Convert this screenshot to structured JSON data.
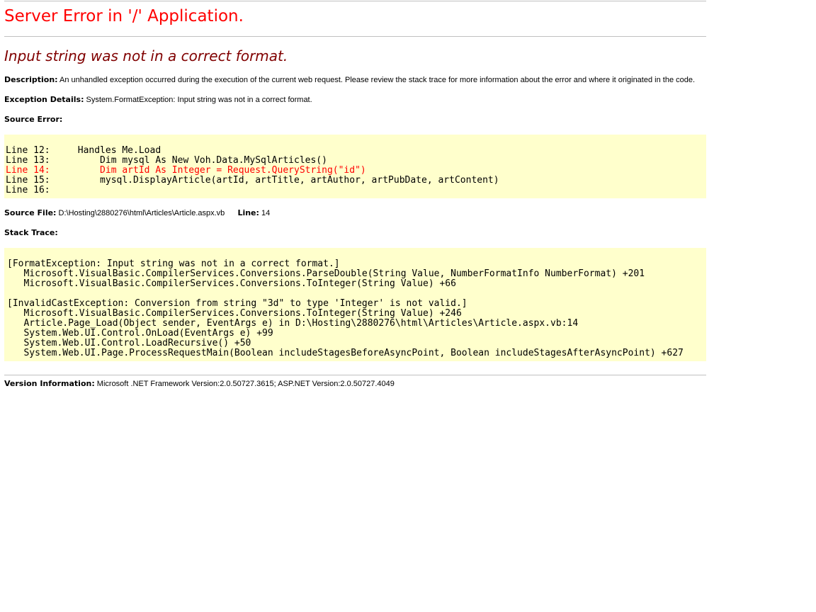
{
  "page": {
    "title": "Server Error in '/' Application.",
    "error_message": "Input string was not in a correct format.",
    "description_label": "Description:",
    "description_text": "An unhandled exception occurred during the execution of the current web request. Please review the stack trace for more information about the error and where it originated in the code.",
    "exception_label": "Exception Details:",
    "exception_text": "System.FormatException: Input string was not in a correct format.",
    "source_error_label": "Source Error:",
    "source_lines": [
      "Line 12:     Handles Me.Load",
      "Line 13:         Dim mysql As New Voh.Data.MySqlArticles()",
      "Line 14:         Dim artId As Integer = Request.QueryString(\"id\")",
      "Line 15:         mysql.DisplayArticle(artId, artTitle, artAuthor, artPubDate, artContent)",
      "Line 16: "
    ],
    "source_file_label": "Source File:",
    "source_file_value": "D:\\Hosting\\2880276\\html\\Articles\\Article.aspx.vb",
    "line_label": "Line:",
    "line_value": "14",
    "stack_trace_label": "Stack Trace:",
    "stack_lines": [
      "[FormatException: Input string was not in a correct format.]",
      "   Microsoft.VisualBasic.CompilerServices.Conversions.ParseDouble(String Value, NumberFormatInfo NumberFormat) +201",
      "   Microsoft.VisualBasic.CompilerServices.Conversions.ToInteger(String Value) +66",
      "",
      "[InvalidCastException: Conversion from string \"3d\" to type 'Integer' is not valid.]",
      "   Microsoft.VisualBasic.CompilerServices.Conversions.ToInteger(String Value) +246",
      "   Article.Page_Load(Object sender, EventArgs e) in D:\\Hosting\\2880276\\html\\Articles\\Article.aspx.vb:14",
      "   System.Web.UI.Control.OnLoad(EventArgs e) +99",
      "   System.Web.UI.Control.LoadRecursive() +50",
      "   System.Web.UI.Page.ProcessRequestMain(Boolean includeStagesBeforeAsyncPoint, Boolean includeStagesAfterAsyncPoint) +627"
    ],
    "version_label": "Version Information:",
    "version_text": "Microsoft .NET Framework Version:2.0.50727.3615; ASP.NET Version:2.0.50727.4049"
  },
  "colors": {
    "title": "#ff0000",
    "error_message": "#800000",
    "code_background": "#ffffcc",
    "highlight_line": "#ff0000",
    "rule": "#c0c0c0"
  }
}
